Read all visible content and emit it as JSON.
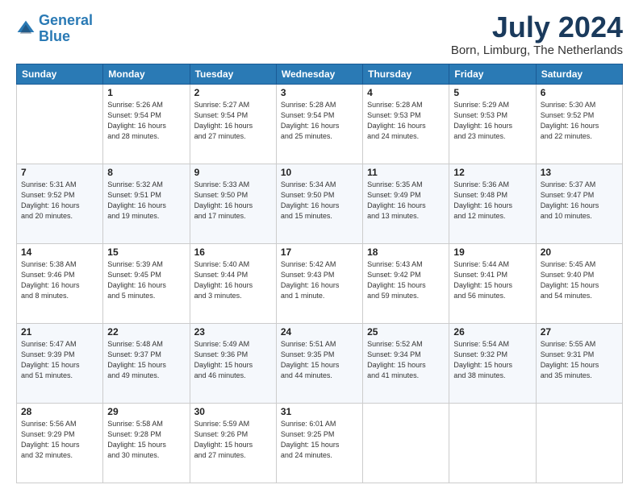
{
  "header": {
    "logo_line1": "General",
    "logo_line2": "Blue",
    "month": "July 2024",
    "location": "Born, Limburg, The Netherlands"
  },
  "days": [
    "Sunday",
    "Monday",
    "Tuesday",
    "Wednesday",
    "Thursday",
    "Friday",
    "Saturday"
  ],
  "weeks": [
    [
      {
        "day": "",
        "content": ""
      },
      {
        "day": "1",
        "content": "Sunrise: 5:26 AM\nSunset: 9:54 PM\nDaylight: 16 hours\nand 28 minutes."
      },
      {
        "day": "2",
        "content": "Sunrise: 5:27 AM\nSunset: 9:54 PM\nDaylight: 16 hours\nand 27 minutes."
      },
      {
        "day": "3",
        "content": "Sunrise: 5:28 AM\nSunset: 9:54 PM\nDaylight: 16 hours\nand 25 minutes."
      },
      {
        "day": "4",
        "content": "Sunrise: 5:28 AM\nSunset: 9:53 PM\nDaylight: 16 hours\nand 24 minutes."
      },
      {
        "day": "5",
        "content": "Sunrise: 5:29 AM\nSunset: 9:53 PM\nDaylight: 16 hours\nand 23 minutes."
      },
      {
        "day": "6",
        "content": "Sunrise: 5:30 AM\nSunset: 9:52 PM\nDaylight: 16 hours\nand 22 minutes."
      }
    ],
    [
      {
        "day": "7",
        "content": "Sunrise: 5:31 AM\nSunset: 9:52 PM\nDaylight: 16 hours\nand 20 minutes."
      },
      {
        "day": "8",
        "content": "Sunrise: 5:32 AM\nSunset: 9:51 PM\nDaylight: 16 hours\nand 19 minutes."
      },
      {
        "day": "9",
        "content": "Sunrise: 5:33 AM\nSunset: 9:50 PM\nDaylight: 16 hours\nand 17 minutes."
      },
      {
        "day": "10",
        "content": "Sunrise: 5:34 AM\nSunset: 9:50 PM\nDaylight: 16 hours\nand 15 minutes."
      },
      {
        "day": "11",
        "content": "Sunrise: 5:35 AM\nSunset: 9:49 PM\nDaylight: 16 hours\nand 13 minutes."
      },
      {
        "day": "12",
        "content": "Sunrise: 5:36 AM\nSunset: 9:48 PM\nDaylight: 16 hours\nand 12 minutes."
      },
      {
        "day": "13",
        "content": "Sunrise: 5:37 AM\nSunset: 9:47 PM\nDaylight: 16 hours\nand 10 minutes."
      }
    ],
    [
      {
        "day": "14",
        "content": "Sunrise: 5:38 AM\nSunset: 9:46 PM\nDaylight: 16 hours\nand 8 minutes."
      },
      {
        "day": "15",
        "content": "Sunrise: 5:39 AM\nSunset: 9:45 PM\nDaylight: 16 hours\nand 5 minutes."
      },
      {
        "day": "16",
        "content": "Sunrise: 5:40 AM\nSunset: 9:44 PM\nDaylight: 16 hours\nand 3 minutes."
      },
      {
        "day": "17",
        "content": "Sunrise: 5:42 AM\nSunset: 9:43 PM\nDaylight: 16 hours\nand 1 minute."
      },
      {
        "day": "18",
        "content": "Sunrise: 5:43 AM\nSunset: 9:42 PM\nDaylight: 15 hours\nand 59 minutes."
      },
      {
        "day": "19",
        "content": "Sunrise: 5:44 AM\nSunset: 9:41 PM\nDaylight: 15 hours\nand 56 minutes."
      },
      {
        "day": "20",
        "content": "Sunrise: 5:45 AM\nSunset: 9:40 PM\nDaylight: 15 hours\nand 54 minutes."
      }
    ],
    [
      {
        "day": "21",
        "content": "Sunrise: 5:47 AM\nSunset: 9:39 PM\nDaylight: 15 hours\nand 51 minutes."
      },
      {
        "day": "22",
        "content": "Sunrise: 5:48 AM\nSunset: 9:37 PM\nDaylight: 15 hours\nand 49 minutes."
      },
      {
        "day": "23",
        "content": "Sunrise: 5:49 AM\nSunset: 9:36 PM\nDaylight: 15 hours\nand 46 minutes."
      },
      {
        "day": "24",
        "content": "Sunrise: 5:51 AM\nSunset: 9:35 PM\nDaylight: 15 hours\nand 44 minutes."
      },
      {
        "day": "25",
        "content": "Sunrise: 5:52 AM\nSunset: 9:34 PM\nDaylight: 15 hours\nand 41 minutes."
      },
      {
        "day": "26",
        "content": "Sunrise: 5:54 AM\nSunset: 9:32 PM\nDaylight: 15 hours\nand 38 minutes."
      },
      {
        "day": "27",
        "content": "Sunrise: 5:55 AM\nSunset: 9:31 PM\nDaylight: 15 hours\nand 35 minutes."
      }
    ],
    [
      {
        "day": "28",
        "content": "Sunrise: 5:56 AM\nSunset: 9:29 PM\nDaylight: 15 hours\nand 32 minutes."
      },
      {
        "day": "29",
        "content": "Sunrise: 5:58 AM\nSunset: 9:28 PM\nDaylight: 15 hours\nand 30 minutes."
      },
      {
        "day": "30",
        "content": "Sunrise: 5:59 AM\nSunset: 9:26 PM\nDaylight: 15 hours\nand 27 minutes."
      },
      {
        "day": "31",
        "content": "Sunrise: 6:01 AM\nSunset: 9:25 PM\nDaylight: 15 hours\nand 24 minutes."
      },
      {
        "day": "",
        "content": ""
      },
      {
        "day": "",
        "content": ""
      },
      {
        "day": "",
        "content": ""
      }
    ]
  ]
}
